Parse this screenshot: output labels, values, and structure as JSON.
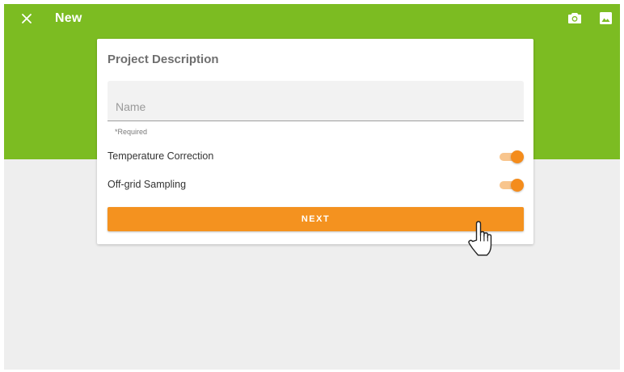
{
  "header": {
    "title": "New",
    "close_icon": "close-icon",
    "camera_icon": "camera-icon",
    "image_icon": "image-icon"
  },
  "card": {
    "title": "Project Description",
    "name_field": {
      "placeholder": "Name",
      "value": ""
    },
    "required_hint": "*Required",
    "toggles": [
      {
        "label": "Temperature Correction",
        "checked": true
      },
      {
        "label": "Off-grid Sampling",
        "checked": true
      }
    ],
    "next_label": "NEXT"
  },
  "colors": {
    "header_green": "#7cbc22",
    "accent_orange": "#f4921f",
    "background": "#eeeeee"
  }
}
